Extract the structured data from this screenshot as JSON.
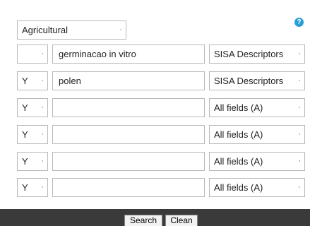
{
  "database": {
    "selected": "Agricultural"
  },
  "help_icon": "?",
  "rows": [
    {
      "operator": "",
      "term": "germinacao in vitro",
      "field": "SISA Descriptors"
    },
    {
      "operator": "Y",
      "term": "polen",
      "field": "SISA Descriptors"
    },
    {
      "operator": "Y",
      "term": "",
      "field": "All fields (A)"
    },
    {
      "operator": "Y",
      "term": "",
      "field": "All fields (A)"
    },
    {
      "operator": "Y",
      "term": "",
      "field": "All fields (A)"
    },
    {
      "operator": "Y",
      "term": "",
      "field": "All fields (A)"
    }
  ],
  "dropdown_arrow": "·",
  "buttons": {
    "search": "Search",
    "clean": "Clean"
  },
  "colors": {
    "footer_bg": "#3a3a3a",
    "help_icon": "#2a9fd6"
  }
}
